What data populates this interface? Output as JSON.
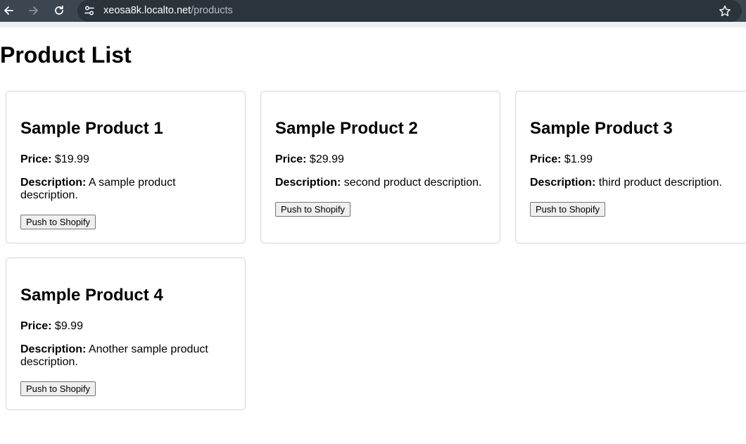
{
  "browser": {
    "url_host": "xeosa8k.localto.net",
    "url_path": "/products",
    "icons": [
      "back-arrow-icon",
      "forward-arrow-icon",
      "reload-icon",
      "site-settings-icon",
      "bookmark-star-icon"
    ]
  },
  "page": {
    "title": "Product List"
  },
  "labels": {
    "price": "Price:",
    "description": "Description:"
  },
  "products": [
    {
      "name": "Sample Product 1",
      "price": "$19.99",
      "description": "A sample product description.",
      "button_label": "Push to Shopify"
    },
    {
      "name": "Sample Product 2",
      "price": "$29.99",
      "description": "second product description.",
      "button_label": "Push to Shopify"
    },
    {
      "name": "Sample Product 3",
      "price": "$1.99",
      "description": "third product description.",
      "button_label": "Push to Shopify"
    },
    {
      "name": "Sample Product 4",
      "price": "$9.99",
      "description": "Another sample product description.",
      "button_label": "Push to Shopify"
    }
  ],
  "colors": {
    "toolbar": "#3c4650",
    "omnibox": "#2b333b",
    "card_border": "#d6d6d6"
  }
}
